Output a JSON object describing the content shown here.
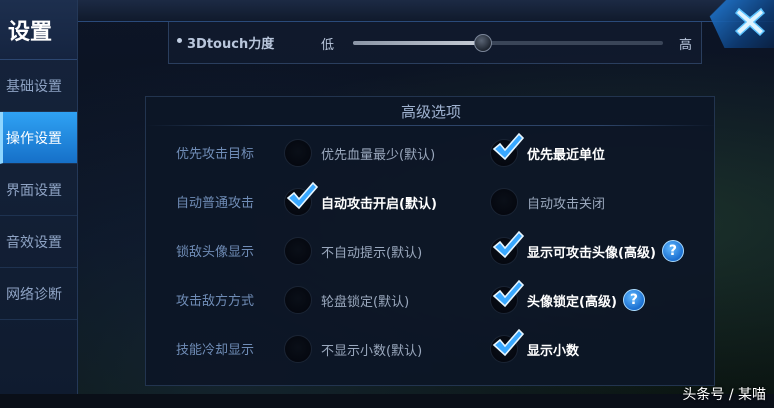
{
  "sidebar": {
    "title": "设置",
    "items": [
      {
        "label": "基础设置",
        "active": false
      },
      {
        "label": "操作设置",
        "active": true
      },
      {
        "label": "界面设置",
        "active": false
      },
      {
        "label": "音效设置",
        "active": false
      },
      {
        "label": "网络诊断",
        "active": false
      }
    ]
  },
  "touch_slider": {
    "label": "3Dtouch力度",
    "low_label": "低",
    "high_label": "高",
    "value_fraction": 0.42
  },
  "advanced": {
    "title": "高级选项",
    "rows": [
      {
        "label": "优先攻击目标",
        "options": [
          {
            "label": "优先血量最少(默认)",
            "selected": false,
            "help": false
          },
          {
            "label": "优先最近单位",
            "selected": true,
            "help": false
          }
        ]
      },
      {
        "label": "自动普通攻击",
        "options": [
          {
            "label": "自动攻击开启(默认)",
            "selected": true,
            "help": false
          },
          {
            "label": "自动攻击关闭",
            "selected": false,
            "help": false
          }
        ]
      },
      {
        "label": "锁敌头像显示",
        "options": [
          {
            "label": "不自动提示(默认)",
            "selected": false,
            "help": false
          },
          {
            "label": "显示可攻击头像(高级)",
            "selected": true,
            "help": true
          }
        ]
      },
      {
        "label": "攻击敌方方式",
        "options": [
          {
            "label": "轮盘锁定(默认)",
            "selected": false,
            "help": false
          },
          {
            "label": "头像锁定(高级)",
            "selected": true,
            "help": true
          }
        ]
      },
      {
        "label": "技能冷却显示",
        "options": [
          {
            "label": "不显示小数(默认)",
            "selected": false,
            "help": false
          },
          {
            "label": "显示小数",
            "selected": true,
            "help": false
          }
        ]
      }
    ]
  },
  "help_glyph": "?",
  "watermark": "头条号 / 某喵",
  "colors": {
    "accent": "#1e88e5",
    "check": "#39a8ff",
    "active_tab": "#2fa2f4"
  },
  "icons": {
    "close": "close-icon",
    "check": "check-icon",
    "help": "help-icon"
  }
}
